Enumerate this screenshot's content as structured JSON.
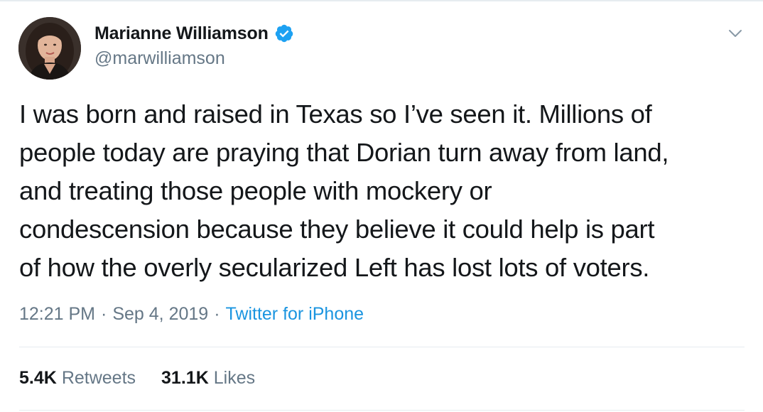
{
  "author": {
    "display_name": "Marianne Williamson",
    "handle": "@marwilliamson",
    "verified": true,
    "avatar": "profile-photo"
  },
  "tweet": {
    "text": "I was born and raised in Texas so I’ve seen it. Millions of\npeople today are praying that Dorian turn away from land,\nand treating those people with mockery or\ncondescension because they believe it could help is part\nof how the overly secularized Left has lost lots of voters."
  },
  "meta": {
    "time": "12:21 PM",
    "separator": "·",
    "date": "Sep 4, 2019",
    "source": "Twitter for iPhone"
  },
  "stats": {
    "retweets_count": "5.4K",
    "retweets_label": "Retweets",
    "likes_count": "31.1K",
    "likes_label": "Likes"
  },
  "icons": {
    "verified": "verified-badge-icon",
    "menu": "chevron-down-icon"
  },
  "colors": {
    "text": "#14171a",
    "secondary": "#657786",
    "link": "#1b95e0",
    "verified": "#1da1f2",
    "border": "#e6ecf0"
  }
}
